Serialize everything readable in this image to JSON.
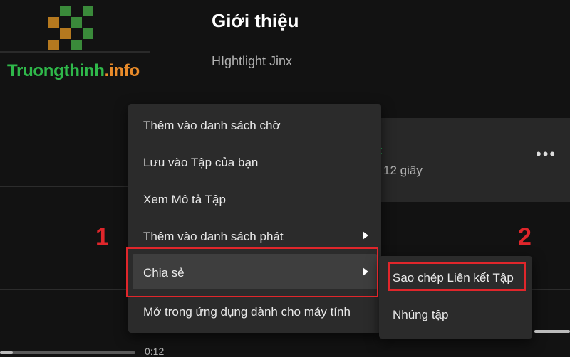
{
  "watermark": {
    "text_green": "Truongthinh",
    "text_orange": ".info"
  },
  "header": {
    "title": "Giới thiệu",
    "subtitle": "HIghtlight Jinx"
  },
  "episode": {
    "title_partial": "nt",
    "meta_partial": "12 giây"
  },
  "context_menu": {
    "items": [
      {
        "label": "Thêm vào danh sách chờ",
        "has_submenu": false
      },
      {
        "label": "Lưu vào Tập của bạn",
        "has_submenu": false
      },
      {
        "label": "Xem Mô tả Tập",
        "has_submenu": false
      },
      {
        "label": "Thêm vào danh sách phát",
        "has_submenu": true
      },
      {
        "label": "Chia sẻ",
        "has_submenu": true
      },
      {
        "label": "Mở trong ứng dụng dành cho máy tính",
        "has_submenu": false
      }
    ]
  },
  "share_submenu": {
    "items": [
      {
        "label": "Sao chép Liên kết Tập"
      },
      {
        "label": "Nhúng tập"
      }
    ]
  },
  "annotations": {
    "step1": "1",
    "step2": "2",
    "color": "#e0262b"
  },
  "player": {
    "elapsed": "0:12"
  },
  "colors": {
    "background": "#121212",
    "menu": "#2b2b2b",
    "accent_green": "#1ed760"
  },
  "icons": [
    "more-icon",
    "chevron-right-icon",
    "logo-icon"
  ]
}
